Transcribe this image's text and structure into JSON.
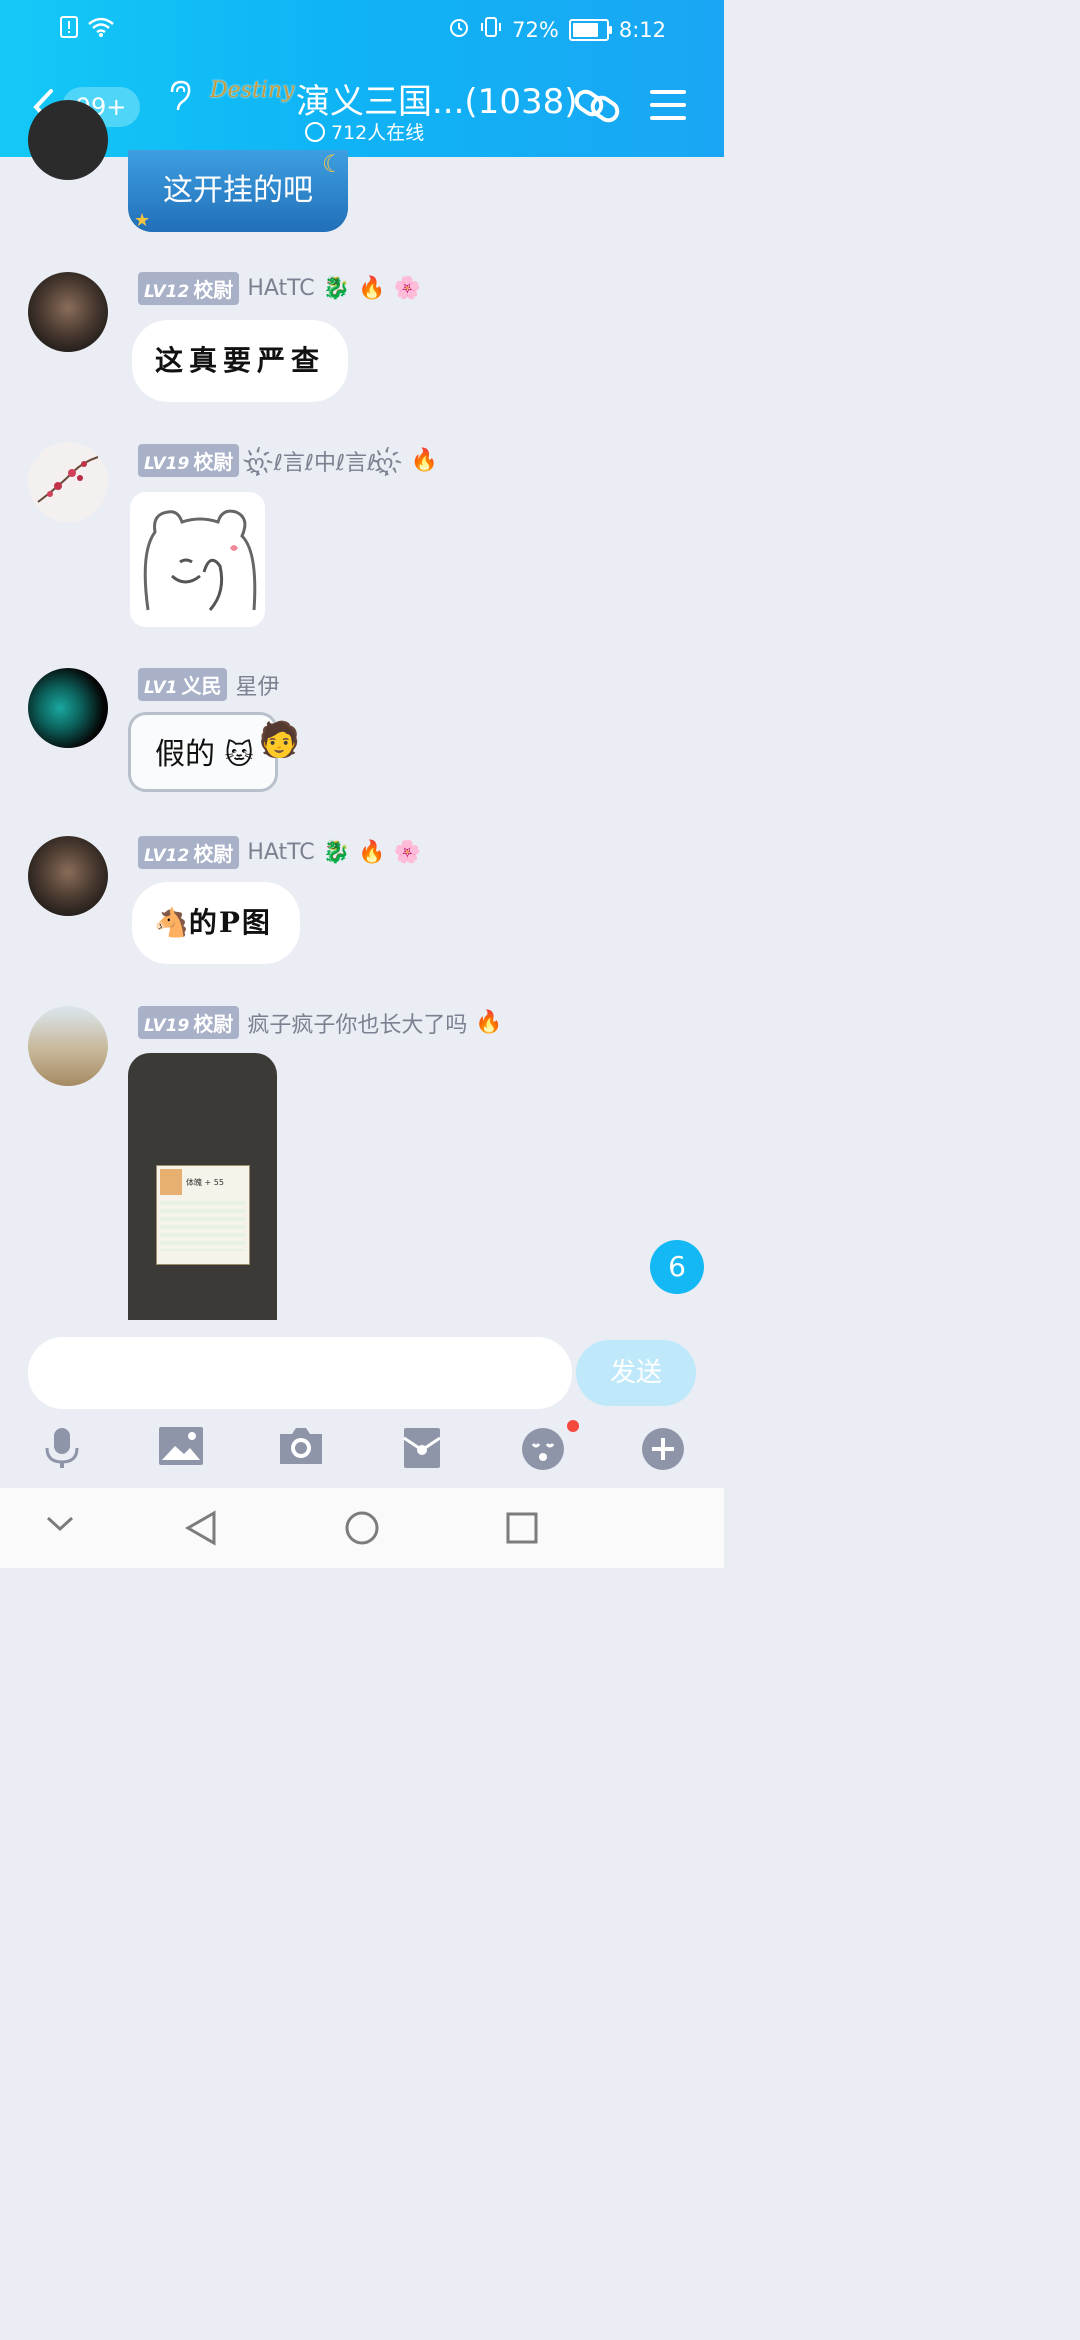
{
  "status": {
    "battery_percent": "72%",
    "time": "8:12"
  },
  "header": {
    "unread_badge": "99+",
    "logo_text": "Destiny",
    "title": "演义三国...(1038)",
    "online_count": "712人在线"
  },
  "messages": [
    {
      "text": "这开挂的吧"
    },
    {
      "level": "LV12",
      "rank": "校尉",
      "name": "HAtTC",
      "text": "这真要严查"
    },
    {
      "level": "LV19",
      "rank": "校尉",
      "name": "ღ҉ℓ言ℓ中ℓ言ℓღ҉"
    },
    {
      "level": "LV1",
      "rank": "义民",
      "name": "星伊",
      "text": "假的"
    },
    {
      "level": "LV12",
      "rank": "校尉",
      "name": "HAtTC",
      "text": "的P图"
    },
    {
      "level": "LV19",
      "rank": "校尉",
      "name": "疯子疯子你也长大了吗"
    }
  ],
  "image_popup": {
    "line1": "体魄 + 55"
  },
  "unread_count": "6",
  "composer": {
    "placeholder": "",
    "send_label": "发送"
  },
  "colors": {
    "header": "#14c9f7",
    "accent": "#13b8f5",
    "background": "#eaedf4"
  }
}
